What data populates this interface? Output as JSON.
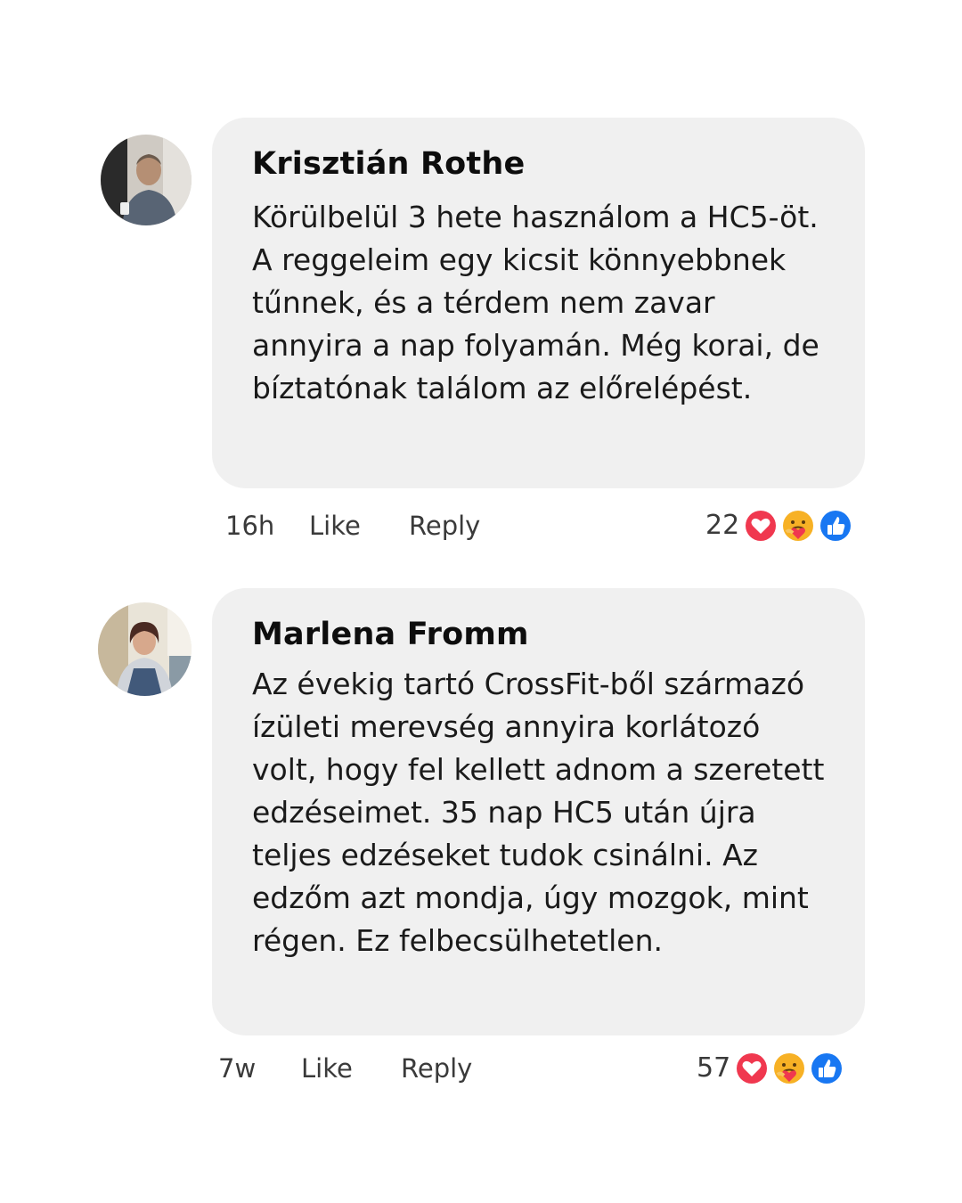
{
  "comments": [
    {
      "author": "Krisztián  Rothe",
      "text": "Körülbelül 3 hete használom a HC5-öt. A reggeleim egy kicsit könnyebbnek tűnnek, és a térdem nem zavar annyira a nap folyamán. Még korai, de bíztatónak találom az előrelépést.",
      "time": "16h",
      "like_label": "Like",
      "reply_label": "Reply",
      "reaction_count": "22",
      "reactions": [
        "heart-icon",
        "care-icon",
        "thumbs-up-icon"
      ]
    },
    {
      "author": "Marlena Fromm",
      "text": "Az évekig tartó CrossFit-ből származó ízületi merevség annyira korlátozó volt, hogy fel kellett adnom a szeretett edzéseimet. 35 nap HC5 után újra teljes edzéseket tudok csinálni. Az edzőm azt mondja, úgy mozgok, mint régen. Ez felbecsülhetetlen.",
      "time": "7w",
      "like_label": "Like",
      "reply_label": "Reply",
      "reaction_count": "57",
      "reactions": [
        "heart-icon",
        "care-icon",
        "thumbs-up-icon"
      ]
    }
  ],
  "colors": {
    "bubble": "#f0f0f0",
    "heart": "#f0384f",
    "care": "#f7b125",
    "like": "#1877f2"
  }
}
